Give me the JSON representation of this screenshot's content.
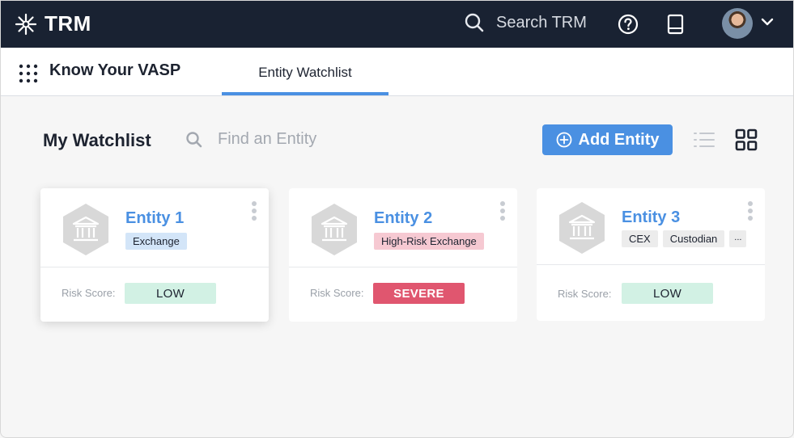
{
  "topbar": {
    "brand": "TRM",
    "search_label": "Search TRM",
    "icons": [
      "trm-logo-icon",
      "search-icon",
      "help-icon",
      "book-icon",
      "avatar",
      "chevron-down-icon"
    ]
  },
  "subnav": {
    "product_title": "Know Your VASP",
    "tab_label": "Entity Watchlist"
  },
  "watchlist": {
    "title": "My Watchlist",
    "search_placeholder": "Find an Entity",
    "add_button_label": "Add Entity"
  },
  "cards": [
    {
      "name": "Entity 1",
      "tags": [
        "Exchange"
      ],
      "risk_label": "Risk Score:",
      "risk_value": "LOW"
    },
    {
      "name": "Entity 2",
      "tags": [
        "High-Risk Exchange"
      ],
      "risk_label": "Risk Score:",
      "risk_value": "SEVERE"
    },
    {
      "name": "Entity 3",
      "tags": [
        "CEX",
        "Custodian",
        "..."
      ],
      "risk_label": "Risk Score:",
      "risk_value": "LOW"
    }
  ],
  "colors": {
    "topbar_bg": "#192232",
    "accent": "#4a90e2",
    "risk_low_bg": "#d2f1e4",
    "risk_severe_bg": "#e0566f",
    "tag_exchange_bg": "#d3e5f8",
    "tag_high_risk_bg": "#f6c9d2"
  }
}
